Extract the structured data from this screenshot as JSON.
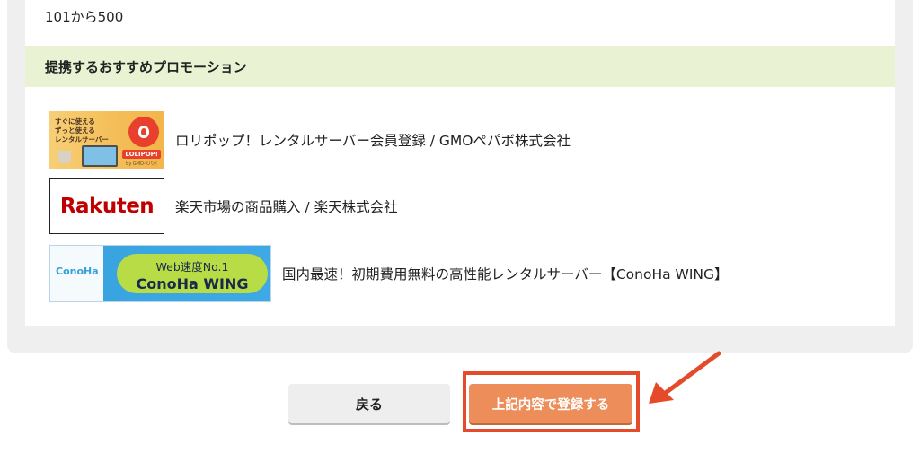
{
  "range": {
    "text": "101から500"
  },
  "promotions": {
    "title": "提携するおすすめプロモーション",
    "items": [
      {
        "label": "ロリポップ！レンタルサーバー会員登録 / GMOペパボ株式会社",
        "banner": {
          "lines": [
            "すぐに使える",
            "ずっと使える",
            "レンタルサーバー"
          ],
          "logo": "LOLIPOP!",
          "sub": "by GMOペパボ"
        }
      },
      {
        "label": "楽天市場の商品購入 / 楽天株式会社",
        "banner": {
          "logo": "Rakuten"
        }
      },
      {
        "label": "国内最速！初期費用無料の高性能レンタルサーバー【ConoHa WING】",
        "banner": {
          "small_logo": "ConoHa",
          "line1": "Web速度No.1",
          "line2": "ConoHa WING"
        }
      }
    ]
  },
  "buttons": {
    "back": "戻る",
    "submit": "上記内容で登録する"
  },
  "colors": {
    "header_bg": "#e9f3d3",
    "submit_bg": "#ec8d5a",
    "highlight": "#e54b2a",
    "rakuten_red": "#bf0000",
    "conoha_blue": "#39a4e0",
    "conoha_green": "#b7dc45"
  }
}
